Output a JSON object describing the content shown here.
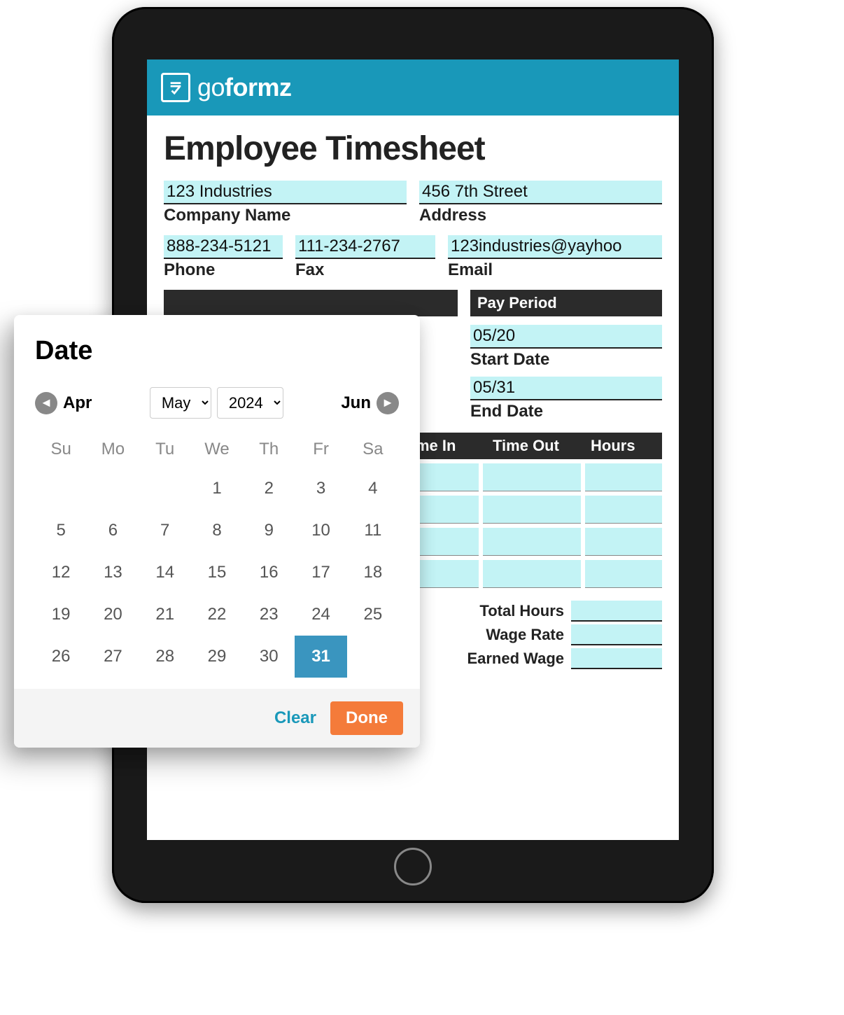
{
  "brand": {
    "name_light": "go",
    "name_bold": "formz"
  },
  "doc": {
    "title": "Employee Timesheet",
    "company": {
      "value": "123 Industries",
      "label": "Company Name"
    },
    "address": {
      "value": "456 7th Street",
      "label": "Address"
    },
    "phone": {
      "value": "888-234-5121",
      "label": "Phone"
    },
    "fax": {
      "value": "111-234-2767",
      "label": "Fax"
    },
    "email": {
      "value": "123industries@yayhoo",
      "label": "Email"
    },
    "pay_period": {
      "title": "Pay Period",
      "start": {
        "value": "05/20",
        "label": "Start Date"
      },
      "end": {
        "value": "05/31",
        "label": "End Date"
      }
    },
    "table": {
      "headers": {
        "timein": "me In",
        "timeout": "Time Out",
        "hours": "Hours"
      }
    },
    "totals": {
      "total_hours": "Total Hours",
      "wage_rate": "Wage Rate",
      "earned_wage": "Earned Wage"
    }
  },
  "datepicker": {
    "title": "Date",
    "prev_month": "Apr",
    "next_month": "Jun",
    "month": "May",
    "year": "2024",
    "weekdays": [
      "Su",
      "Mo",
      "Tu",
      "We",
      "Th",
      "Fr",
      "Sa"
    ],
    "first_day_index": 3,
    "days_in_month": 31,
    "selected_day": 31,
    "clear": "Clear",
    "done": "Done"
  }
}
